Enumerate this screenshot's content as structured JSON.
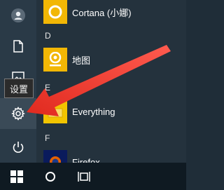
{
  "sidebar": {
    "items": [
      {
        "name": "user",
        "icon": "user-icon"
      },
      {
        "name": "documents",
        "icon": "document-icon"
      },
      {
        "name": "pictures",
        "icon": "picture-icon"
      },
      {
        "name": "settings",
        "icon": "gear-icon"
      },
      {
        "name": "power",
        "icon": "power-icon"
      }
    ],
    "tooltip": "设置"
  },
  "apps": {
    "cortana": {
      "label": "Cortana (小娜)",
      "tile_color": "#f2b705"
    },
    "section_d": "D",
    "ditu": {
      "label": "地图",
      "tile_color": "#f2b705"
    },
    "section_e": "E",
    "everything": {
      "label": "Everything",
      "tile_color": "#f2c500"
    },
    "section_f": "F",
    "firefox": {
      "label": "Firefox",
      "tile_color": "#0a1b5c"
    }
  },
  "taskbar": {
    "items": [
      {
        "name": "start",
        "icon": "windows-logo-icon"
      },
      {
        "name": "search",
        "icon": "cortana-circle-icon"
      },
      {
        "name": "task-view",
        "icon": "task-view-icon"
      }
    ]
  },
  "annotation": {
    "arrow_color": "#e8332a"
  }
}
